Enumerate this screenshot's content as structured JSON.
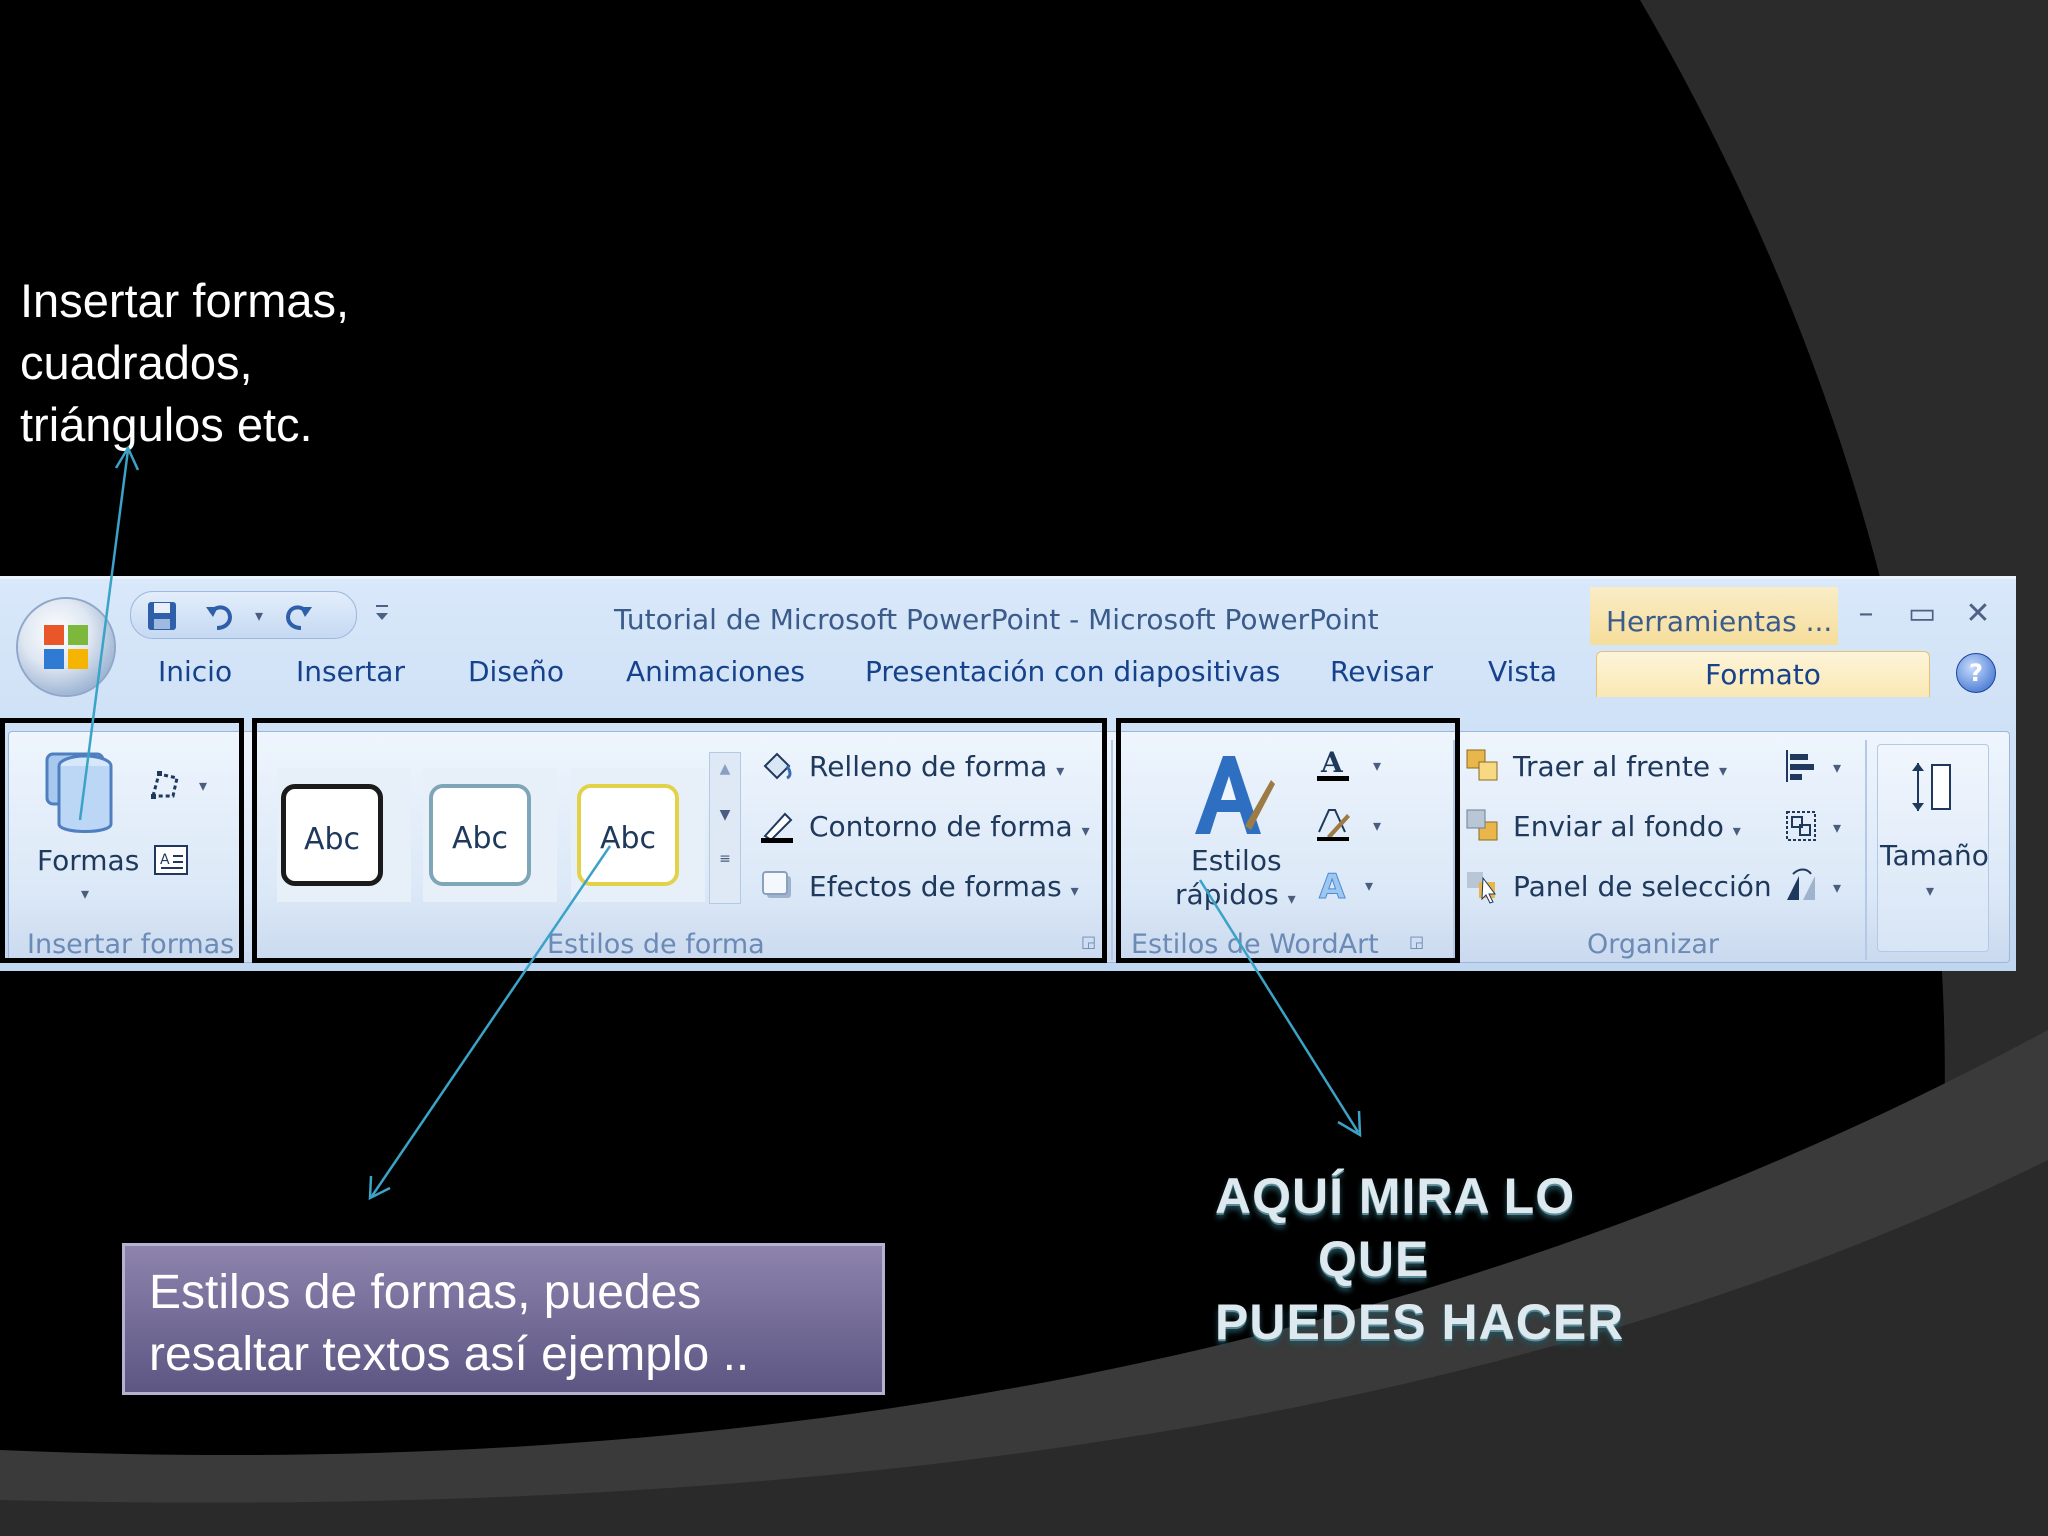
{
  "annotations": {
    "shapes_note": [
      "Insertar formas,",
      "cuadrados,",
      "triángulos etc."
    ],
    "styles_note": [
      "Estilos de formas, puedes",
      "resaltar textos así ejemplo .."
    ],
    "callout": [
      "AQUÍ MIRA LO",
      "QUE",
      "PUEDES HACER"
    ]
  },
  "window": {
    "title": "Tutorial de Microsoft PowerPoint - Microsoft PowerPoint",
    "context_tab": "Herramientas ...",
    "minimize": "–",
    "maximize": "▭",
    "close": "✕"
  },
  "tabs": [
    "Inicio",
    "Insertar",
    "Diseño",
    "Animaciones",
    "Presentación con diapositivas",
    "Revisar",
    "Vista",
    "Formato"
  ],
  "groups": {
    "insert_shapes": {
      "label": "Insertar formas",
      "shapes_button": "Formas"
    },
    "shape_styles": {
      "label": "Estilos de forma",
      "swatches": [
        "Abc",
        "Abc",
        "Abc"
      ],
      "fill": "Relleno de forma",
      "outline": "Contorno de forma",
      "effects": "Efectos de formas"
    },
    "wordart": {
      "label": "Estilos de WordArt",
      "quick_styles_1": "Estilos",
      "quick_styles_2": "rápidos"
    },
    "arrange": {
      "label": "Organizar",
      "bring_front": "Traer al frente",
      "send_back": "Enviar al fondo",
      "selection_pane": "Panel de selección"
    },
    "size": {
      "label": "Tamaño"
    }
  },
  "colors": {
    "background": "#000000",
    "ribbon_text": "#15428b",
    "annotation_arrow": "#3aa3c7",
    "context_tab": "#fae8b4"
  }
}
